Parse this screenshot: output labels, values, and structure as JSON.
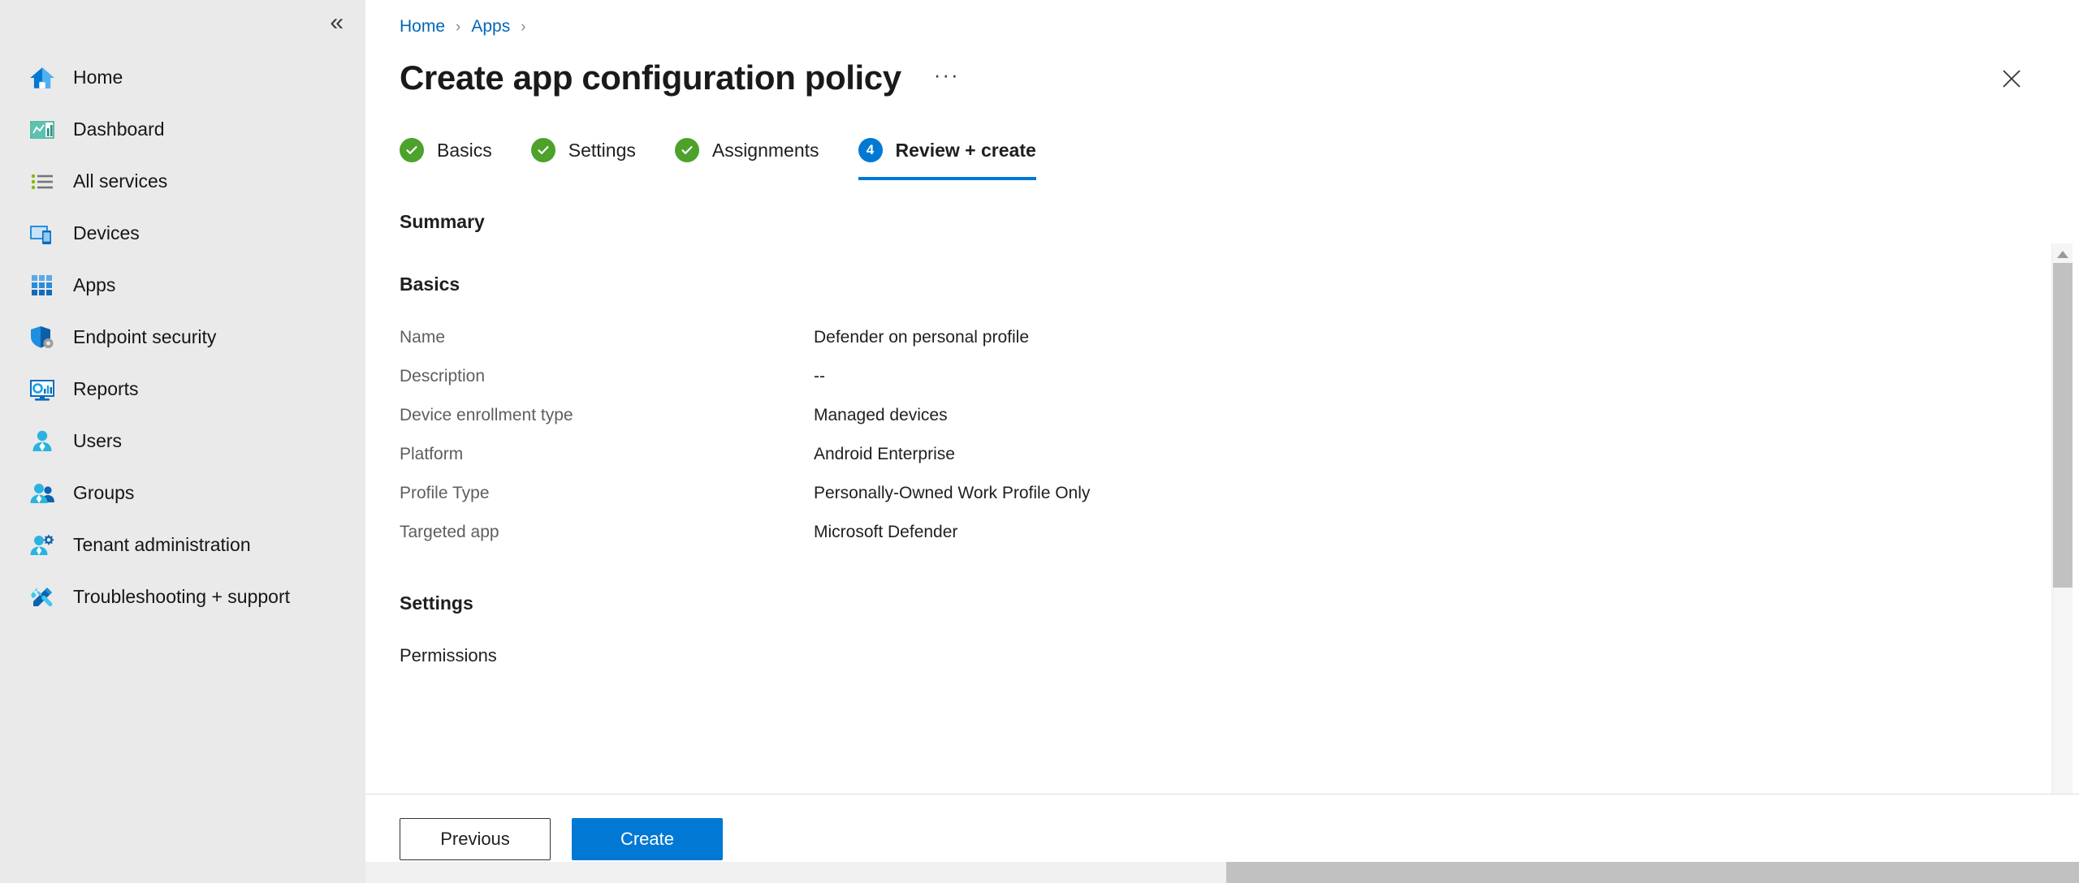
{
  "sidebar": {
    "collapse_glyph": "«",
    "items": [
      {
        "label": "Home",
        "icon": "home-icon"
      },
      {
        "label": "Dashboard",
        "icon": "dashboard-icon"
      },
      {
        "label": "All services",
        "icon": "all-services-icon"
      },
      {
        "label": "Devices",
        "icon": "devices-icon"
      },
      {
        "label": "Apps",
        "icon": "apps-grid-icon"
      },
      {
        "label": "Endpoint security",
        "icon": "shield-gear-icon"
      },
      {
        "label": "Reports",
        "icon": "reports-monitor-icon"
      },
      {
        "label": "Users",
        "icon": "user-icon"
      },
      {
        "label": "Groups",
        "icon": "groups-icon"
      },
      {
        "label": "Tenant administration",
        "icon": "user-gear-icon"
      },
      {
        "label": "Troubleshooting + support",
        "icon": "wrench-screwdriver-icon"
      }
    ]
  },
  "header": {
    "breadcrumb": [
      "Home",
      "Apps"
    ],
    "breadcrumb_separator": "›",
    "title": "Create app configuration policy",
    "ellipsis": "···",
    "close_label": "Close"
  },
  "wizard": {
    "tabs": [
      {
        "label": "Basics",
        "state": "done",
        "number": "1"
      },
      {
        "label": "Settings",
        "state": "done",
        "number": "2"
      },
      {
        "label": "Assignments",
        "state": "done",
        "number": "3"
      },
      {
        "label": "Review + create",
        "state": "current",
        "number": "4"
      }
    ]
  },
  "main": {
    "summary_heading": "Summary",
    "basics_heading": "Basics",
    "basics_rows": [
      {
        "key": "Name",
        "value": "Defender on personal profile"
      },
      {
        "key": "Description",
        "value": "--"
      },
      {
        "key": "Device enrollment type",
        "value": "Managed devices"
      },
      {
        "key": "Platform",
        "value": "Android Enterprise"
      },
      {
        "key": "Profile Type",
        "value": "Personally-Owned Work Profile Only"
      },
      {
        "key": "Targeted app",
        "value": "Microsoft Defender"
      }
    ],
    "settings_heading": "Settings",
    "permissions_label": "Permissions"
  },
  "footer": {
    "previous_label": "Previous",
    "create_label": "Create"
  },
  "colors": {
    "accent": "#0078d4",
    "link": "#0067b8",
    "success": "#4CA22B",
    "sidebar_bg": "#eaeaea",
    "scrollbar_thumb": "#c1c1c1"
  }
}
